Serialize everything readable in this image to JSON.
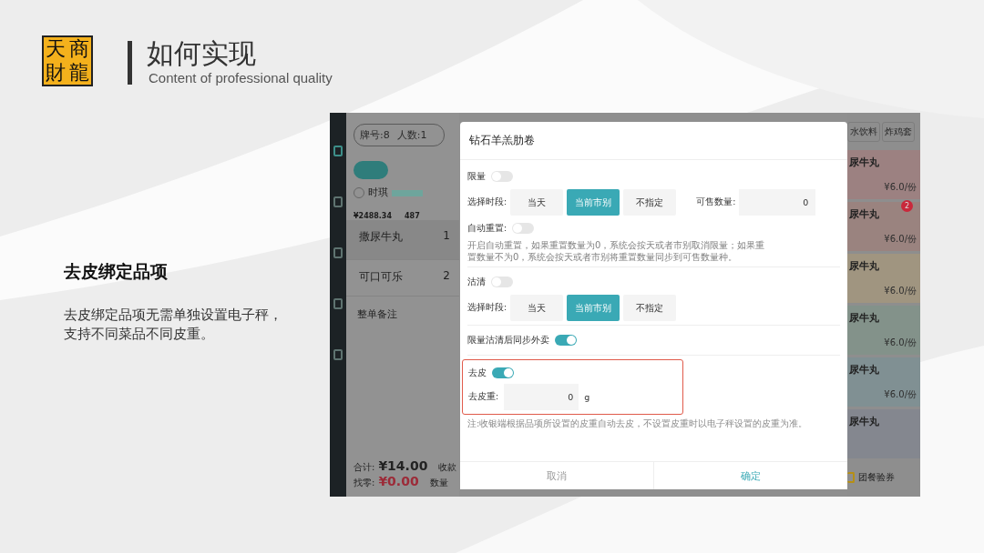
{
  "slide": {
    "logo": [
      "天",
      "商",
      "財",
      "龍"
    ],
    "title": "如何实现",
    "subtitle": "Content of professional quality",
    "feature_title": "去皮绑定品项",
    "feature_text": [
      "去皮绑定品项无需单独设置电子秤，",
      "支持不同菜品不同皮重。"
    ]
  },
  "app": {
    "order": {
      "table_tag": "牌号:8",
      "guests_tag": "人数:1",
      "member_name": "时琪",
      "balance": "¥2488.34",
      "points": "487",
      "items": [
        {
          "name": "撒尿牛丸",
          "qty": "1"
        },
        {
          "name": "可口可乐",
          "qty": "2"
        }
      ],
      "remark": "整单备注",
      "total_label": "合计:",
      "total": "¥14.00",
      "change_label": "找零:",
      "change": "¥0.00",
      "pay_label": "收款",
      "qty_label": "数量"
    },
    "categories": [
      "水饮料",
      "炸鸡套"
    ],
    "menu": [
      {
        "name": "尿牛丸",
        "price": "¥6.0/份",
        "color": "#9c8181"
      },
      {
        "name": "尿牛丸",
        "price": "¥6.0/份",
        "badge": "2",
        "color": "#9a837f"
      },
      {
        "name": "尿牛丸",
        "price": "¥6.0/份",
        "color": "#a09580"
      },
      {
        "name": "尿牛丸",
        "price": "¥6.0/份",
        "color": "#83928a"
      },
      {
        "name": "尿牛丸",
        "price": "¥6.0/份",
        "color": "#809093"
      },
      {
        "name": "尿牛丸",
        "color": "#84878f"
      }
    ],
    "group_voucher": "团餐验券",
    "dialog": {
      "title": "钻石羊羔肋卷",
      "sections": [
        {
          "kind": "toggle",
          "label": "限量",
          "on": false
        },
        {
          "kind": "segments",
          "label": "选择时段:",
          "options": [
            {
              "label": "当天",
              "selected": false
            },
            {
              "label": "当前市别",
              "selected": true
            },
            {
              "label": "不指定",
              "selected": false
            }
          ],
          "qty_label": "可售数量:",
          "qty_value": "0"
        },
        {
          "kind": "toggle",
          "label": "自动重置:",
          "on": false
        },
        {
          "kind": "hint",
          "text": "开启自动重置，如果重置数量为0，系统会按天或者市别取消限量；如果重置数量不为0，系统会按天或者市别将重置数量同步到可售数量种。"
        },
        {
          "kind": "divider"
        },
        {
          "kind": "toggle",
          "label": "沽清",
          "on": false
        },
        {
          "kind": "segments",
          "label": "选择时段:",
          "options": [
            {
              "label": "当天",
              "selected": false
            },
            {
              "label": "当前市别",
              "selected": true
            },
            {
              "label": "不指定",
              "selected": false
            }
          ]
        },
        {
          "kind": "divider"
        },
        {
          "kind": "toggle",
          "label": "限量沽清后同步外卖",
          "on": true
        },
        {
          "kind": "divider"
        },
        {
          "kind": "highlight",
          "children": [
            {
              "kind": "toggle",
              "label": "去皮",
              "on": true
            },
            {
              "kind": "weight",
              "label": "去皮重:",
              "value": "0",
              "unit": "g"
            }
          ]
        },
        {
          "kind": "note",
          "text": "注:收银端根据品项所设置的皮重自动去皮，不设置皮重时以电子秤设置的皮重为准。"
        }
      ],
      "cancel": "取消",
      "confirm": "确定"
    }
  }
}
